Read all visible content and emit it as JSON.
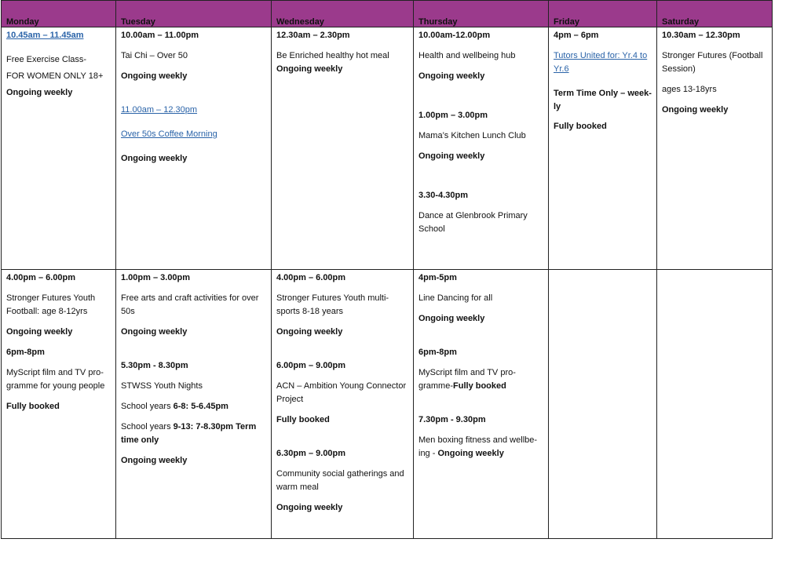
{
  "days": [
    "Monday",
    "Tuesday",
    "Wednesday",
    "Thursday",
    "Friday",
    "Saturday"
  ],
  "row1": {
    "monday": {
      "time": "10.45am – 11.45am",
      "title": "Free Exercise Class-",
      "sub": "FOR WOMEN ONLY 18+",
      "status": "Ongoing weekly"
    },
    "tuesday": {
      "time1": "10.00am – 11.00pm",
      "title1": "Tai Chi – Over 50",
      "status1": "Ongoing weekly",
      "time2": "11.00am – 12.30pm",
      "title2": "Over 50s Coffee Morning",
      "status2": "Ongoing weekly"
    },
    "wednesday": {
      "time": "12.30am – 2.30pm",
      "title": "Be Enriched healthy hot meal",
      "status": "Ongoing weekly"
    },
    "thursday": {
      "time1": "10.00am-12.00pm",
      "title1": "Health and wellbeing hub",
      "status1": "Ongoing weekly",
      "time2": "1.00pm – 3.00pm",
      "title2": "Mama’s Kitchen Lunch Club",
      "status2": "Ongoing weekly",
      "time3": "3.30-4.30pm",
      "title3": "Dance at Glenbrook Primary School"
    },
    "friday": {
      "time": "4pm – 6pm",
      "title": "Tutors United for: Yr.4 to Yr.6",
      "note": "Term Time Only – week-ly",
      "status": "Fully booked"
    },
    "saturday": {
      "time": "10.30am – 12.30pm",
      "title": "Stronger Futures (Football Session)",
      "sub": "ages 13-18yrs",
      "status": "Ongoing weekly"
    }
  },
  "row2": {
    "monday": {
      "time1": "4.00pm – 6.00pm",
      "title1": "Stronger Futures Youth Football: age 8-12yrs",
      "status1": "Ongoing weekly",
      "time2": "6pm-8pm",
      "title2": "MyScript film and TV pro-gramme for young people",
      "status2": "Fully booked"
    },
    "tuesday": {
      "time1": "1.00pm – 3.00pm",
      "title1": "Free arts and craft activities for over 50s",
      "status1": "Ongoing weekly",
      "time2": "5.30pm - 8.30pm",
      "title2": "STWSS Youth Nights",
      "yearsA_label": "School years ",
      "yearsA_value": "6-8: 5-6.45pm",
      "yearsB_label": "School years ",
      "yearsB_value": "9-13: 7-8.30pm Term time only",
      "status2": "Ongoing weekly"
    },
    "wednesday": {
      "time1": "4.00pm – 6.00pm",
      "title1": "Stronger Futures Youth multi-sports 8-18 years",
      "status1": "Ongoing weekly",
      "time2": "6.00pm – 9.00pm",
      "title2": "ACN – Ambition Young Connector Project",
      "status2": "Fully booked",
      "time3": "6.30pm – 9.00pm",
      "title3": "Community social gatherings and warm meal",
      "status3": "Ongoing weekly"
    },
    "thursday": {
      "time1": "4pm-5pm",
      "title1": "Line Dancing for all",
      "status1": "Ongoing weekly",
      "time2": "6pm-8pm",
      "title2": "MyScript film and TV pro-gramme-",
      "status2": "Fully booked",
      "time3": "7.30pm - 9.30pm",
      "title3": "Men boxing fitness and wellbe-ing - ",
      "status3": "Ongoing weekly"
    }
  }
}
